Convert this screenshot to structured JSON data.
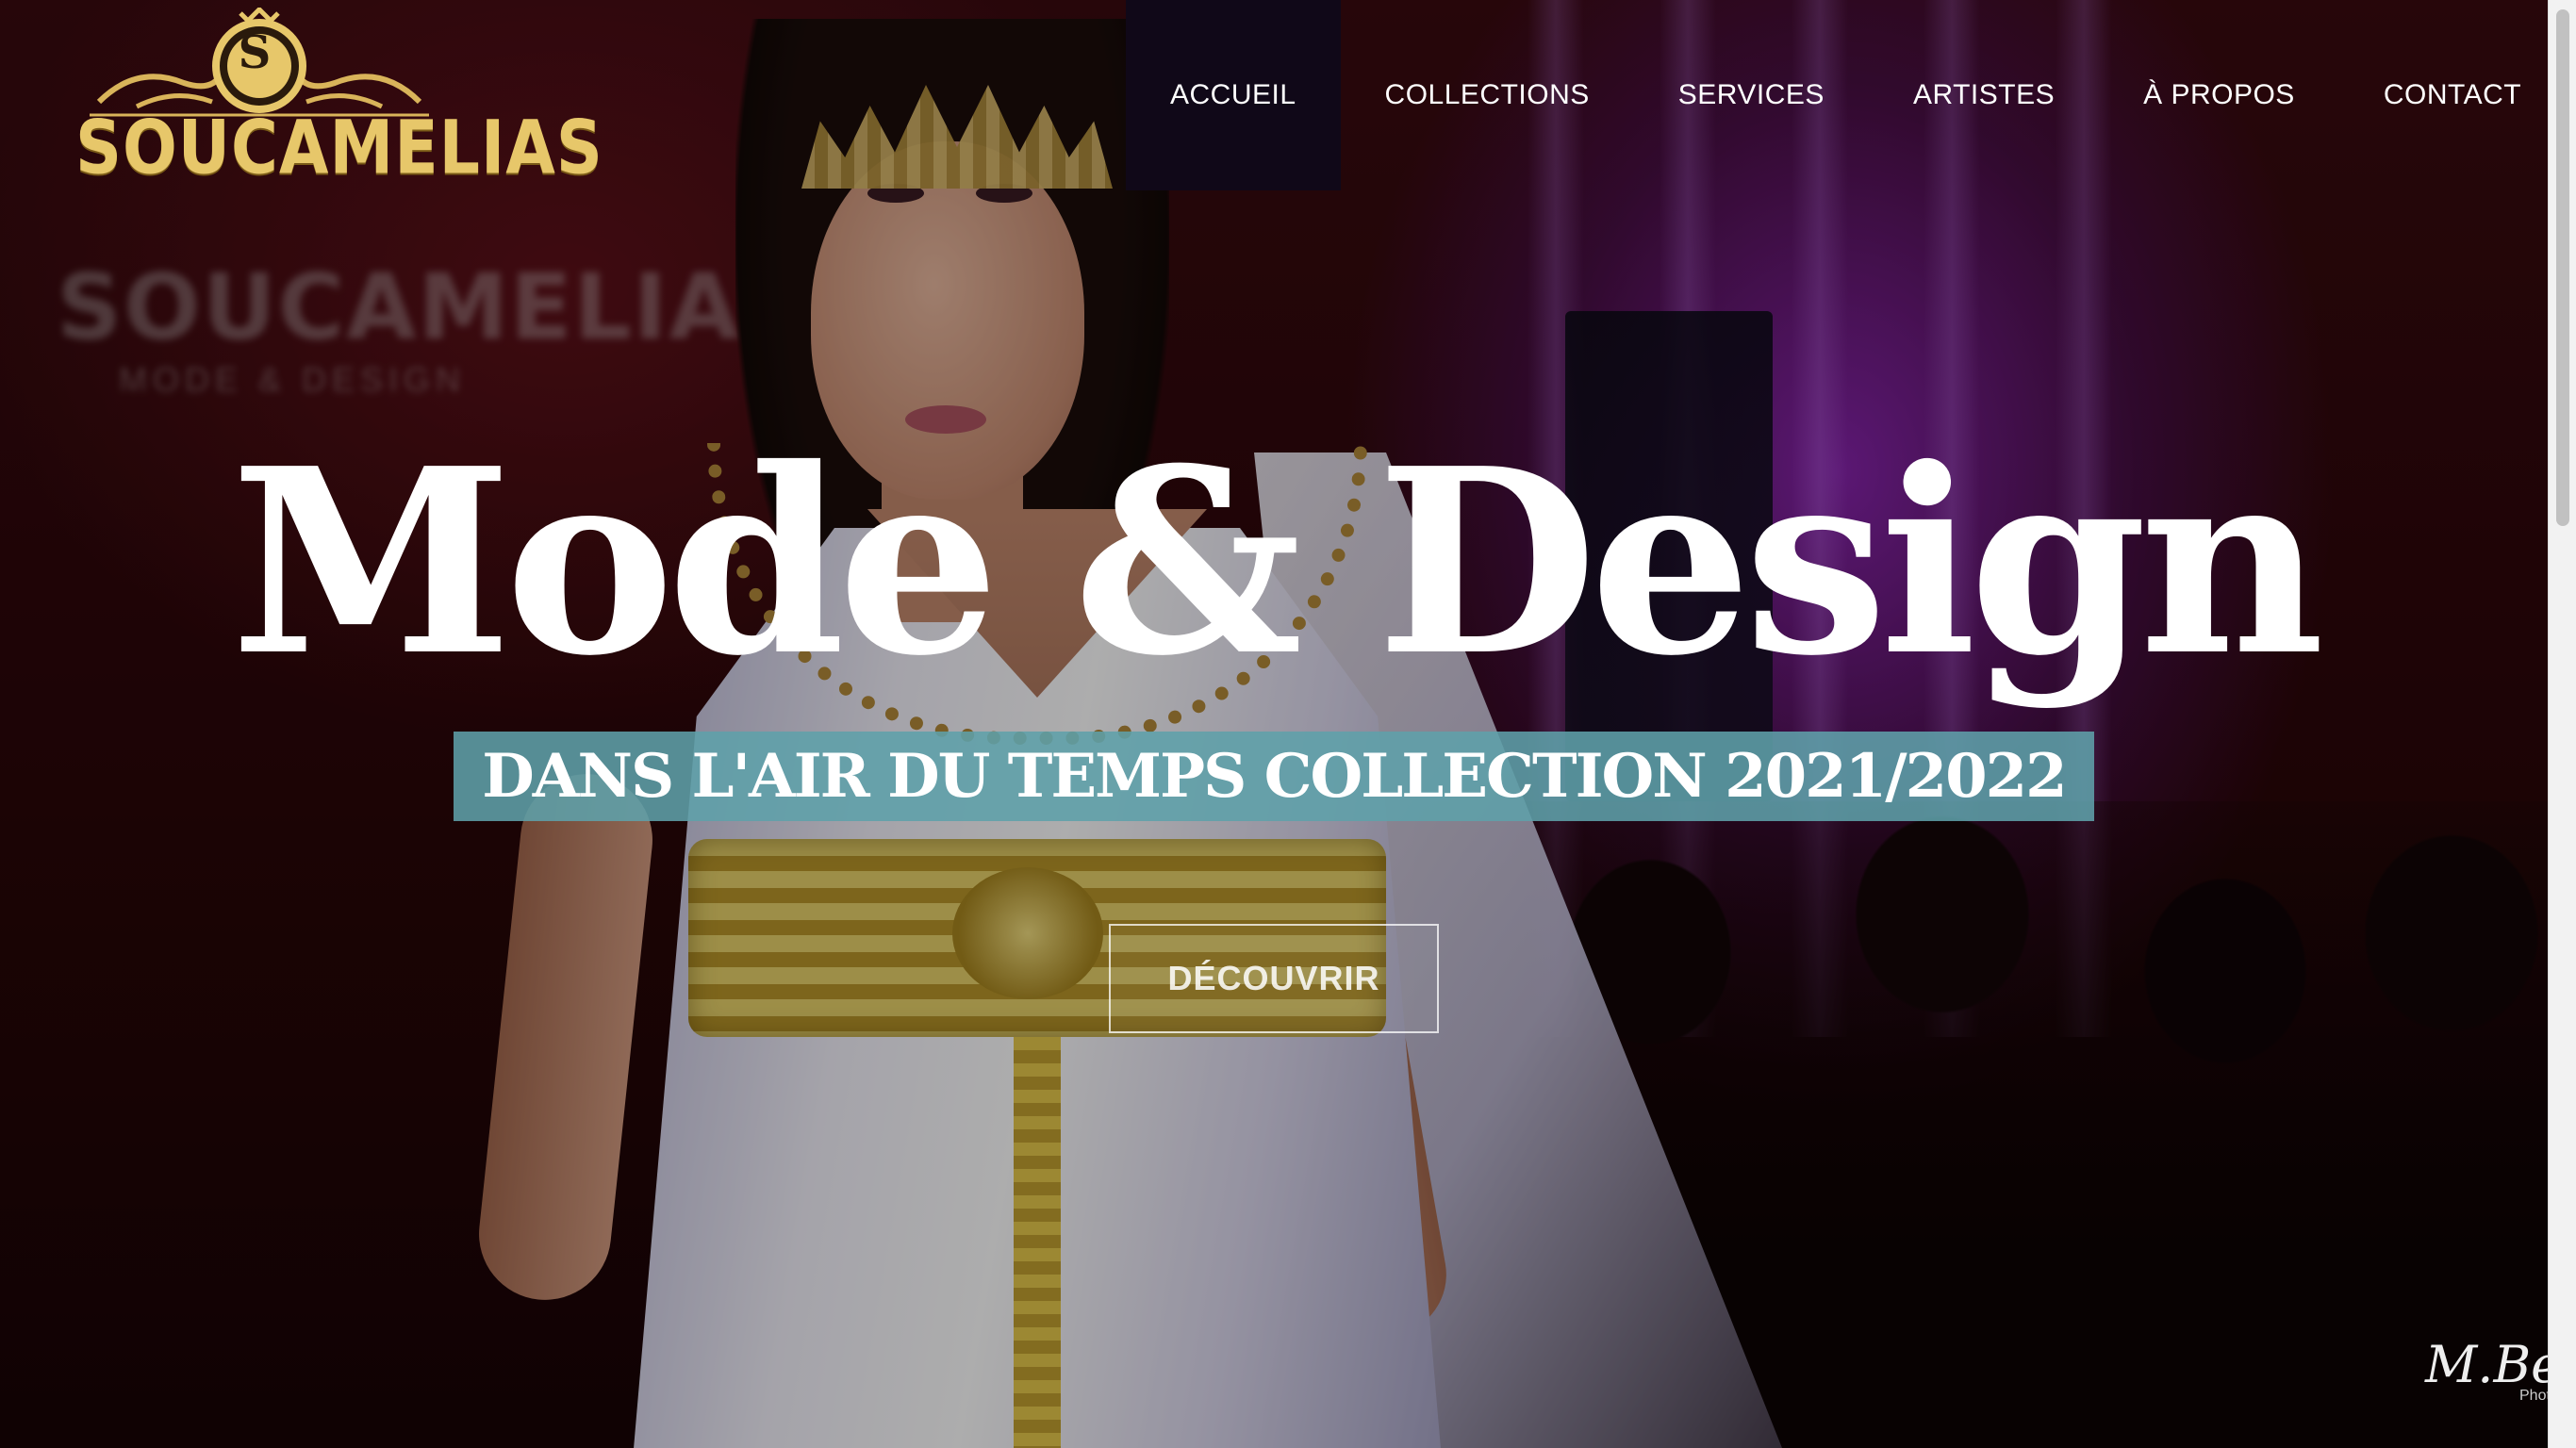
{
  "brand": {
    "name": "SOUCAMELIAS",
    "monogram": "S",
    "ghost_name": "SOUCAMELIAS",
    "ghost_tagline": "MODE & DESIGN",
    "gold_color": "#e7c76a"
  },
  "nav": {
    "items": [
      {
        "label": "ACCUEIL",
        "active": true
      },
      {
        "label": "COLLECTIONS",
        "active": false
      },
      {
        "label": "SERVICES",
        "active": false
      },
      {
        "label": "ARTISTES",
        "active": false
      },
      {
        "label": "À PROPOS",
        "active": false
      },
      {
        "label": "CONTACT",
        "active": false
      }
    ],
    "active_bg": "#100818"
  },
  "hero": {
    "headline": "Mode & Design",
    "subline": "DANS L'AIR DU TEMPS COLLECTION 2021/2022",
    "subline_bg": "#5fa0aa",
    "cta_label": "DÉCOUVRIR",
    "watermark": "M.Belm",
    "watermark_sub": "Photo"
  }
}
